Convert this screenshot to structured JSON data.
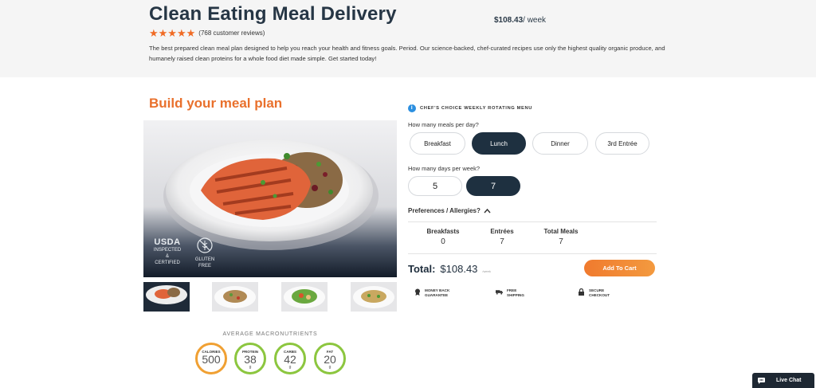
{
  "header": {
    "title": "Clean Eating Meal Delivery",
    "price": "$108.43",
    "price_suffix": "/ week",
    "stars": "★★★★★",
    "reviews": "(768 customer reviews)",
    "description": "The best prepared clean meal plan designed to help you reach your health and fitness goals. Period. Our science-backed, chef-curated recipes use only the highest quality organic produce, and humanely raised clean proteins for a whole food diet made simple. Get started today!"
  },
  "builder": {
    "title": "Build your meal plan",
    "badges": {
      "usda": "USDA",
      "usda_line1": "INSPECTED",
      "usda_line2": "& CERTIFIED",
      "gluten_line1": "GLUTEN",
      "gluten_line2": "FREE"
    },
    "macros": {
      "title": "AVERAGE MACRONUTRIENTS",
      "items": [
        {
          "label": "CALORIES",
          "value": "500",
          "unit": ""
        },
        {
          "label": "PROTEIN",
          "value": "38",
          "unit": "g"
        },
        {
          "label": "CARBS",
          "value": "42",
          "unit": "g"
        },
        {
          "label": "FAT",
          "value": "20",
          "unit": "g"
        }
      ]
    }
  },
  "options": {
    "chef_label": "CHEF'S CHOICE WEEKLY ROTATING MENU",
    "meals_question": "How many meals per day?",
    "meals": [
      "Breakfast",
      "Lunch",
      "Dinner",
      "3rd Entrée"
    ],
    "meals_selected": "Lunch",
    "days_question": "How many days per week?",
    "days": [
      "5",
      "7"
    ],
    "days_selected": "7",
    "prefs_label": "Preferences / Allergies?"
  },
  "summary": {
    "cols": [
      {
        "label": "Breakfasts",
        "value": "0"
      },
      {
        "label": "Entrées",
        "value": "7"
      },
      {
        "label": "Total Meals",
        "value": "7"
      }
    ],
    "total_label": "Total:",
    "total_value": "$108.43",
    "total_small": "/week",
    "cart_button": "Add To Cart"
  },
  "guarantees": [
    {
      "line1": "MONEY BACK",
      "line2": "GUARANTEE"
    },
    {
      "line1": "FREE",
      "line2": "SHIPPING"
    },
    {
      "line1": "SECURE",
      "line2": "CHECKOUT"
    }
  ],
  "chat": {
    "label": "Live Chat"
  },
  "colors": {
    "accent": "#e9702c",
    "dark": "#1e3040",
    "macro_green": "#8cc63f",
    "macro_orange": "#f0a033"
  }
}
